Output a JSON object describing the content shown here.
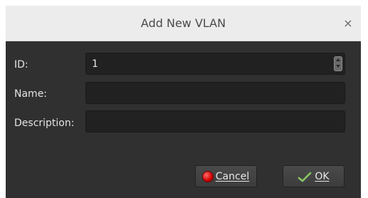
{
  "dialog": {
    "title": "Add New VLAN",
    "close_glyph": "×"
  },
  "form": {
    "id": {
      "label": "ID:",
      "value": "1"
    },
    "name": {
      "label": "Name:",
      "value": ""
    },
    "description": {
      "label": "Description:",
      "value": ""
    }
  },
  "buttons": {
    "cancel": {
      "label": "Cancel",
      "icon": "red-stop-icon"
    },
    "ok": {
      "label": "OK",
      "icon": "green-check-pencil-icon"
    }
  },
  "colors": {
    "dialog_bg": "#303030",
    "field_bg": "#212121",
    "titlebar_bg": "#ececec"
  }
}
